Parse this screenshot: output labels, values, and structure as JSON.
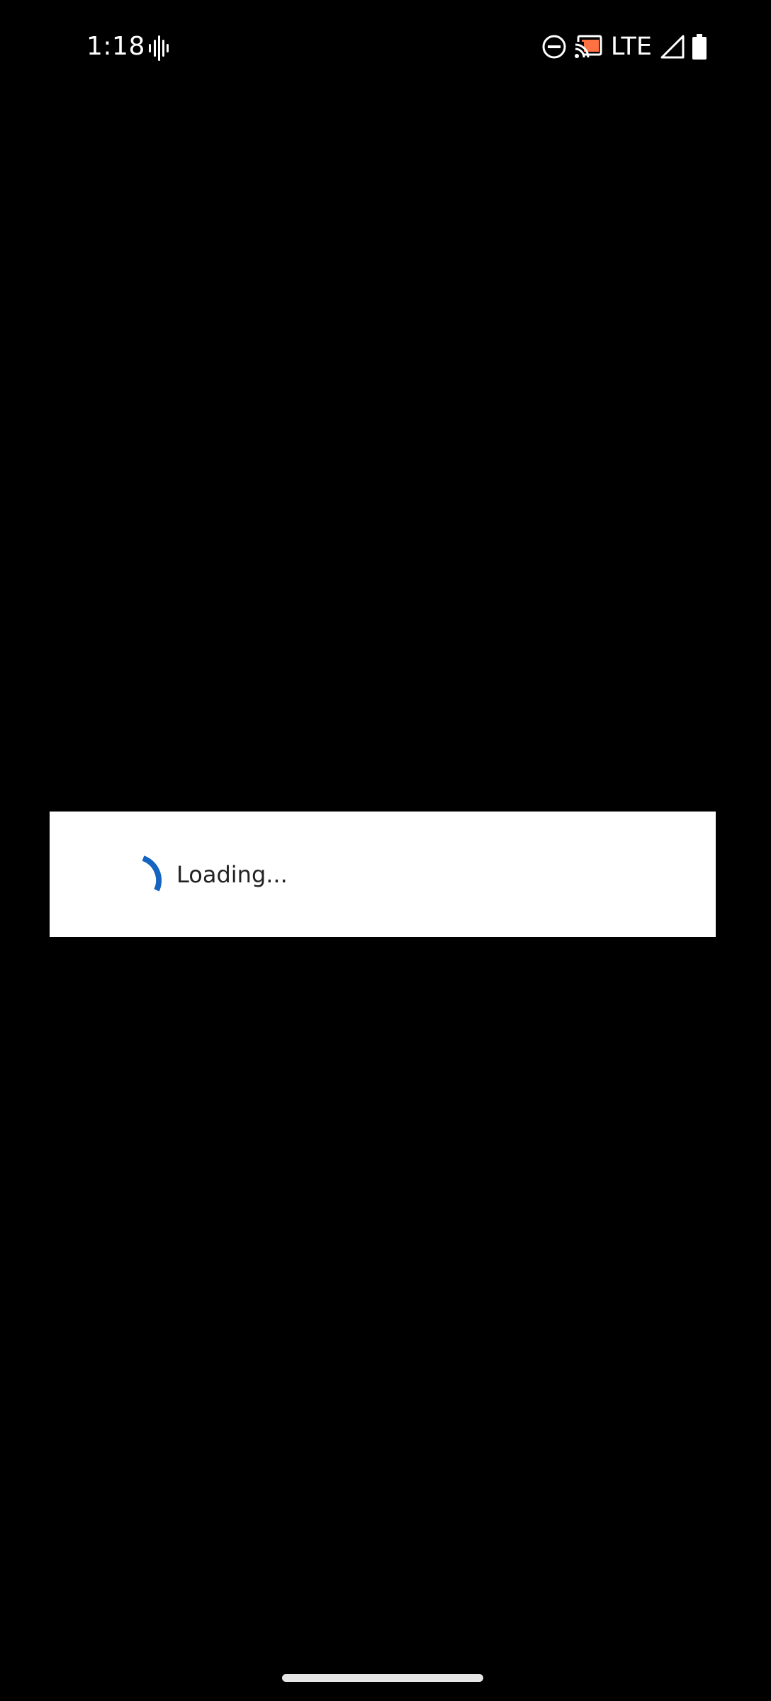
{
  "status_bar": {
    "time": "1:18",
    "network": "LTE",
    "icons": [
      "sound-wave-icon",
      "do-not-disturb-icon",
      "cast-icon",
      "signal-icon",
      "battery-icon"
    ],
    "cast_color": "#ff7043"
  },
  "dialog": {
    "message": "Loading...",
    "spinner_color": "#1565c0"
  },
  "theme": {
    "background": "#000000",
    "dialog_background": "#ffffff",
    "text_color": "#222222"
  }
}
